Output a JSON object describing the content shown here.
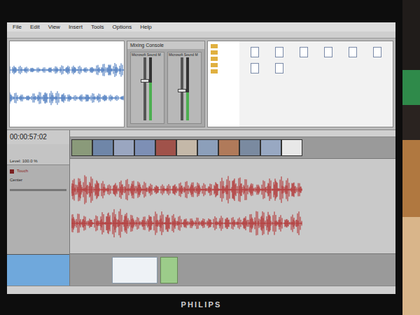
{
  "monitor": {
    "brand": "PHILIPS"
  },
  "app": {
    "menu": [
      "File",
      "Edit",
      "View",
      "Insert",
      "Tools",
      "Options",
      "Help"
    ],
    "mixer": {
      "title": "Mixing Console",
      "channels": [
        {
          "name": "Microsoft Sound M",
          "level": 0.6
        },
        {
          "name": "Microsoft Sound M",
          "level": 0.45
        }
      ]
    },
    "timeline": {
      "time": "00:00:57:02",
      "video_track": {
        "level_label": "Level: 100.0 %"
      },
      "audio_track": {
        "mode": "Touch",
        "pan": "Center",
        "muted": false
      }
    }
  }
}
